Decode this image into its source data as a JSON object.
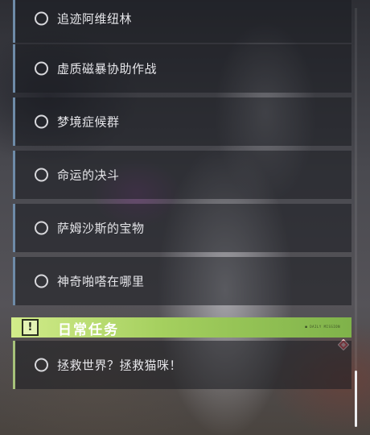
{
  "quests": [
    {
      "label": "追迹阿维纽林"
    },
    {
      "label": "虚质磁暴协助作战"
    },
    {
      "label": "梦境症候群"
    },
    {
      "label": "命运的决斗"
    },
    {
      "label": "萨姆沙斯的宝物"
    },
    {
      "label": "神奇啪嗒在哪里"
    }
  ],
  "daily_section": {
    "title": "日常任务",
    "badge": "!",
    "deco_text": "■ DAILY MISSION",
    "quests": [
      {
        "label": "拯救世界？拯救猫咪！"
      }
    ]
  },
  "colors": {
    "main_quest_accent": "#6e8ba8",
    "daily_accent": "#a6c27a",
    "header_green": "#c2e07a",
    "tracker_marker": "#e04a55"
  },
  "icons": {
    "quest_status": "circle-outline-icon",
    "section_badge": "exclamation-icon",
    "tracker": "diamond-marker-icon"
  }
}
